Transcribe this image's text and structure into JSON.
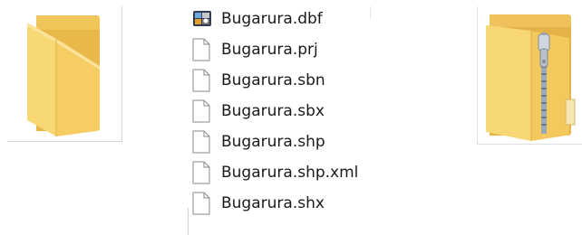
{
  "icons": {
    "folder": "folder-icon",
    "zip": "zip-folder-icon",
    "database": "database-file-icon",
    "generic": "generic-file-icon"
  },
  "colors": {
    "folder_front": "#f8d775",
    "folder_back": "#e8b84a",
    "text": "#1a1a1a",
    "file_outline": "#8a8a8a"
  },
  "files": [
    {
      "name": "Bugarura.dbf",
      "icon": "database-file-icon"
    },
    {
      "name": "Bugarura.prj",
      "icon": "generic-file-icon"
    },
    {
      "name": "Bugarura.sbn",
      "icon": "generic-file-icon"
    },
    {
      "name": "Bugarura.sbx",
      "icon": "generic-file-icon"
    },
    {
      "name": "Bugarura.shp",
      "icon": "generic-file-icon"
    },
    {
      "name": "Bugarura.shp.xml",
      "icon": "generic-file-icon"
    },
    {
      "name": "Bugarura.shx",
      "icon": "generic-file-icon"
    }
  ]
}
